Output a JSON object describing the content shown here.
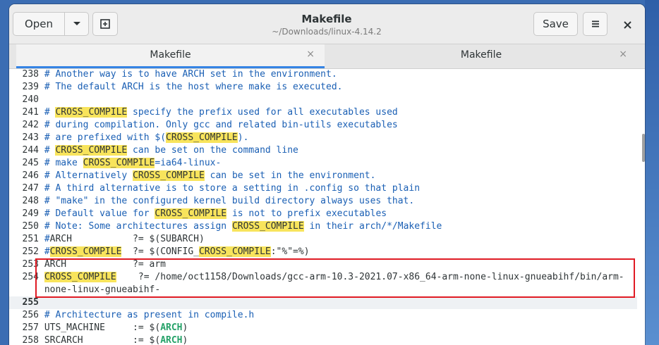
{
  "header": {
    "open_label": "Open",
    "open_menu_icon": "chevron-down-icon",
    "new_tab_icon": "new-document-icon",
    "title": "Makefile",
    "subtitle": "~/Downloads/linux-4.14.2",
    "save_label": "Save",
    "menu_icon": "hamburger-icon",
    "close_icon": "close-icon"
  },
  "tabs": [
    {
      "label": "Makefile",
      "active": true,
      "close": "×"
    },
    {
      "label": "Makefile",
      "active": false,
      "close": "×"
    }
  ],
  "editor": {
    "current_line": "255",
    "lines": [
      {
        "n": "238",
        "text": "# Another way is to have ARCH set in the environment."
      },
      {
        "n": "239",
        "text": "# The default ARCH is the host where make is executed."
      },
      {
        "n": "240",
        "text": ""
      },
      {
        "n": "241",
        "text": "# CROSS_COMPILE specify the prefix used for all executables used"
      },
      {
        "n": "242",
        "text": "# during compilation. Only gcc and related bin-utils executables"
      },
      {
        "n": "243",
        "text": "# are prefixed with $(CROSS_COMPILE)."
      },
      {
        "n": "244",
        "text": "# CROSS_COMPILE can be set on the command line"
      },
      {
        "n": "245",
        "text": "# make CROSS_COMPILE=ia64-linux-"
      },
      {
        "n": "246",
        "text": "# Alternatively CROSS_COMPILE can be set in the environment."
      },
      {
        "n": "247",
        "text": "# A third alternative is to store a setting in .config so that plain"
      },
      {
        "n": "248",
        "text": "# \"make\" in the configured kernel build directory always uses that."
      },
      {
        "n": "249",
        "text": "# Default value for CROSS_COMPILE is not to prefix executables"
      },
      {
        "n": "250",
        "text": "# Note: Some architectures assign CROSS_COMPILE in their arch/*/Makefile"
      },
      {
        "n": "251",
        "text": "#ARCH           ?= $(SUBARCH)"
      },
      {
        "n": "252",
        "text": "#CROSS_COMPILE  ?= $(CONFIG_CROSS_COMPILE:\"%\"=%)"
      },
      {
        "n": "253",
        "text": "ARCH            ?= arm"
      },
      {
        "n": "254",
        "text": "CROSS_COMPILE    ?= /home/oct1158/Downloads/gcc-arm-10.3-2021.07-x86_64-arm-none-linux-gnueabihf/bin/arm-"
      },
      {
        "n": "",
        "text": "none-linux-gnueabihf-"
      },
      {
        "n": "255",
        "text": ""
      },
      {
        "n": "256",
        "text": "# Architecture as present in compile.h"
      },
      {
        "n": "257",
        "text": "UTS_MACHINE     := $(ARCH)"
      },
      {
        "n": "258",
        "text": "SRCARCH         := $(ARCH)"
      }
    ]
  },
  "search_highlight": "CROSS_COMPILE",
  "colors": {
    "highlight": "#f8e45c",
    "comment": "#1a5fb4",
    "keyword": "#26a269",
    "annotation_box": "#e01b24",
    "tab_accent": "#3584e4"
  }
}
